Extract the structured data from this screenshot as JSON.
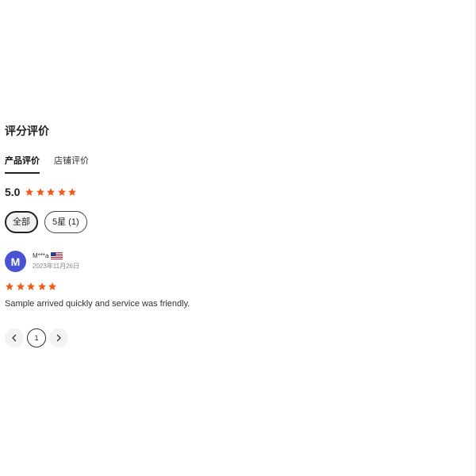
{
  "section": {
    "title": "评分评价"
  },
  "tabs": [
    {
      "label": "产品评价",
      "active": true
    },
    {
      "label": "店铺评价",
      "active": false
    }
  ],
  "rating": {
    "score": "5.0",
    "stars": 5,
    "star_color": "#f05a1a"
  },
  "filters": [
    {
      "label": "全部",
      "active": true
    },
    {
      "label": "5星 (1)",
      "active": false
    }
  ],
  "review": {
    "avatar_letter": "M",
    "avatar_color": "#4a52d4",
    "reviewer": "M***a",
    "flag_icon": "us-flag-icon",
    "date": "2023年11月26日",
    "stars": 5,
    "text": "Sample arrived quickly and service was friendly."
  },
  "pagination": {
    "current_page": "1",
    "prev_icon": "chevron-left-icon",
    "next_icon": "chevron-right-icon"
  }
}
